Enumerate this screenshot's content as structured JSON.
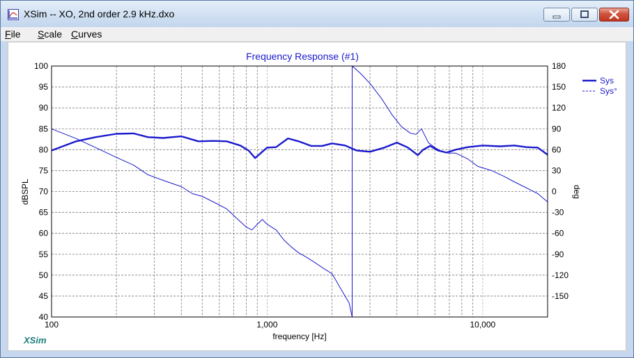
{
  "window": {
    "title": "XSim -- XO, 2nd order 2.9 kHz.dxo",
    "buttons": {
      "minimize": "minimize",
      "maximize": "maximize",
      "close": "close"
    }
  },
  "menu": {
    "items": [
      {
        "underline": "F",
        "rest": "ile"
      },
      {
        "underline": "S",
        "rest": "cale"
      },
      {
        "underline": "C",
        "rest": "urves"
      }
    ]
  },
  "branding": {
    "label": "XSim"
  },
  "colors": {
    "accent": "#1a1acc",
    "brand": "#1b7d7d",
    "grid": "#7a7a7a"
  },
  "chart_data": {
    "type": "line",
    "title": "Frequency Response (#1)",
    "xlabel": "frequency [Hz]",
    "ylabel": "dBSPL",
    "y2label": "deg",
    "xscale": "log",
    "xlim": [
      100,
      20000
    ],
    "ylim": [
      40,
      100
    ],
    "y2lim": [
      -180,
      180
    ],
    "grid": true,
    "legend": "top-right",
    "x_ticks": [
      "100",
      "1,000",
      "10,000"
    ],
    "y_ticks": [
      "40",
      "45",
      "50",
      "55",
      "60",
      "65",
      "70",
      "75",
      "80",
      "85",
      "90",
      "95",
      "100"
    ],
    "y2_ticks": [
      "180",
      "150",
      "120",
      "90",
      "60",
      "30",
      "0",
      "-30",
      "-60",
      "-90",
      "-120",
      "-150"
    ],
    "series": [
      {
        "name": "Sys",
        "axis": "left",
        "style": "solid-thick",
        "x": [
          100,
          130,
          160,
          200,
          240,
          280,
          330,
          400,
          480,
          560,
          650,
          750,
          820,
          880,
          950,
          1000,
          1100,
          1250,
          1400,
          1600,
          1800,
          2000,
          2300,
          2600,
          3000,
          3500,
          4000,
          4500,
          5000,
          5300,
          5700,
          6200,
          6800,
          7500,
          8500,
          10000,
          12000,
          14000,
          16000,
          18000,
          20000
        ],
        "values": [
          79.8,
          82.0,
          83.0,
          83.8,
          83.9,
          83.0,
          82.8,
          83.2,
          82.0,
          82.1,
          82.0,
          81.0,
          79.8,
          78.0,
          79.5,
          80.5,
          80.6,
          82.7,
          82.0,
          80.9,
          80.9,
          81.5,
          81.0,
          79.8,
          79.5,
          80.5,
          81.7,
          80.5,
          78.7,
          80.0,
          80.9,
          79.8,
          79.3,
          80.0,
          80.6,
          81.0,
          80.8,
          81.0,
          80.6,
          80.5,
          78.8
        ]
      },
      {
        "name": "Sys°",
        "axis": "right",
        "style": "dashed-thin",
        "x": [
          100,
          130,
          160,
          200,
          240,
          280,
          330,
          400,
          450,
          500,
          580,
          650,
          720,
          800,
          850,
          900,
          950,
          1000,
          1100,
          1200,
          1300,
          1400,
          1500,
          1650,
          1800,
          2000,
          2200,
          2400,
          2480,
          2480,
          2700,
          3000,
          3400,
          3800,
          4200,
          4600,
          4900,
          5200,
          5600,
          6000,
          6500,
          7000,
          7500,
          8500,
          9500,
          11000,
          12500,
          14000,
          16000,
          18000,
          20000
        ],
        "values": [
          90,
          76,
          63,
          49,
          38,
          24,
          16,
          7,
          -3,
          -7,
          -17,
          -25,
          -38,
          -51,
          -55,
          -47,
          -40,
          -47,
          -55,
          -70,
          -80,
          -88,
          -93,
          -101,
          -109,
          -118,
          -140,
          -160,
          -180,
          180,
          170,
          155,
          133,
          110,
          93,
          84,
          82,
          90,
          70,
          63,
          57,
          55,
          55,
          47,
          36,
          30,
          22,
          14,
          5,
          -3,
          -15
        ]
      }
    ]
  }
}
